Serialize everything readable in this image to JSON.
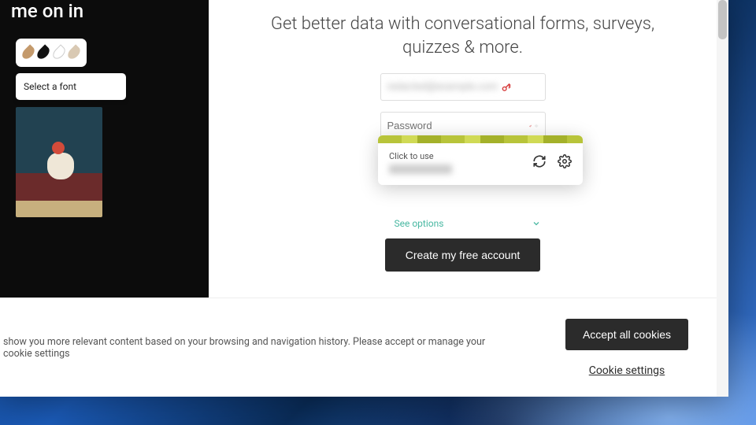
{
  "left": {
    "title_fragment": "me on in",
    "swatches": [
      "#c49a6c",
      "#111111",
      "#ffffff",
      "#d9c9b3"
    ],
    "font_dropdown_label": "Select a font"
  },
  "signup": {
    "headline_line1": "Get better data with conversational forms, surveys,",
    "headline_line2": "quizzes & more.",
    "email_value": "redacted@example.com",
    "password_placeholder": "Password",
    "see_options_label": "See options",
    "cta_label": "Create my free account"
  },
  "password_manager": {
    "hint": "Click to use",
    "suggestion": "redacted"
  },
  "cookies": {
    "message_fragment": "show you more relevant content based on your browsing and navigation history. Please accept or manage your cookie settings",
    "accept_label": "Accept all cookies",
    "settings_label": "Cookie settings"
  }
}
